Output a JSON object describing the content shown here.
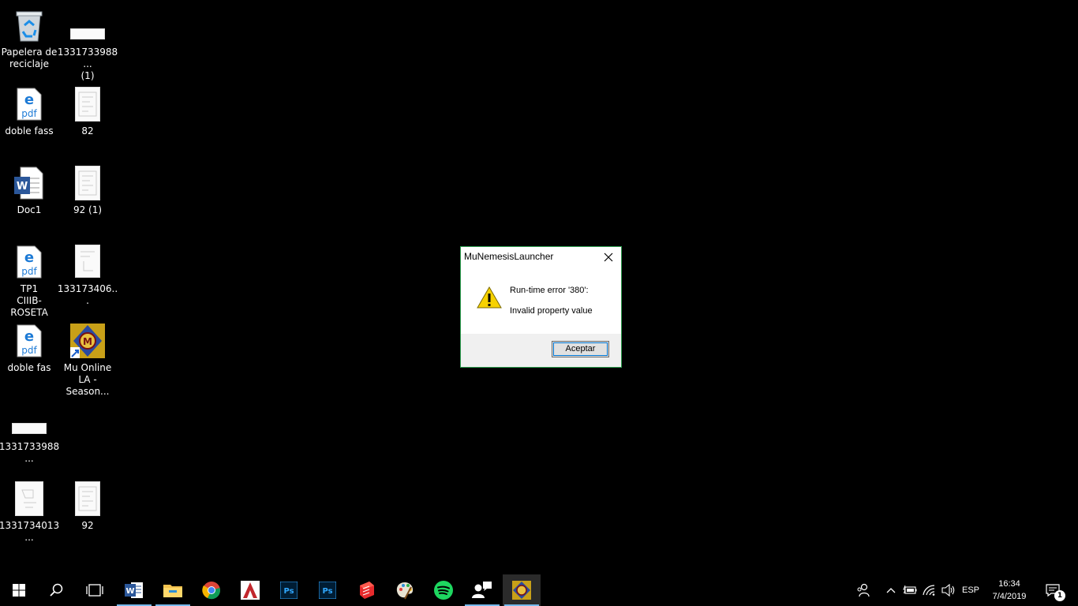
{
  "desktop": {
    "icons": [
      {
        "label": "Papelera de reciclaje",
        "icon": "recycle-bin-icon"
      },
      {
        "label": "1331733988...\n(1)",
        "icon": "image-file-icon"
      },
      {
        "label": "doble fass",
        "icon": "pdf-edge-icon"
      },
      {
        "label": "82",
        "icon": "image-file-icon"
      },
      {
        "label": "Doc1",
        "icon": "word-document-icon"
      },
      {
        "label": "92 (1)",
        "icon": "image-file-icon"
      },
      {
        "label": "TP1\nCIIIB-ROSETA",
        "icon": "pdf-edge-icon"
      },
      {
        "label": "133173406...",
        "icon": "image-file-icon"
      },
      {
        "label": "doble fas",
        "icon": "pdf-edge-icon"
      },
      {
        "label": "Mu Online\nLA - Season...",
        "icon": "mu-online-shortcut-icon"
      },
      {
        "label": "1331733988...",
        "icon": "image-file-icon"
      },
      {
        "label": "1331734013...",
        "icon": "image-file-icon"
      },
      {
        "label": "92",
        "icon": "image-file-icon"
      }
    ]
  },
  "dialog": {
    "title": "MuNemesisLauncher",
    "message_line1": "Run-time error '380':",
    "message_line2": "Invalid property value",
    "ok_label": "Aceptar",
    "icon": "warning-icon"
  },
  "taskbar": {
    "pinned": [
      {
        "name": "start",
        "icon": "windows-start-icon"
      },
      {
        "name": "search",
        "icon": "search-icon"
      },
      {
        "name": "task-view",
        "icon": "task-view-icon"
      },
      {
        "name": "word",
        "icon": "word-icon"
      },
      {
        "name": "file-explorer",
        "icon": "folder-icon"
      },
      {
        "name": "chrome",
        "icon": "chrome-icon"
      },
      {
        "name": "autocad",
        "icon": "autocad-icon"
      },
      {
        "name": "photoshop-1",
        "icon": "photoshop-icon"
      },
      {
        "name": "photoshop-2",
        "icon": "photoshop-icon"
      },
      {
        "name": "sketchup",
        "icon": "sketchup-icon"
      },
      {
        "name": "paint",
        "icon": "palette-icon"
      },
      {
        "name": "spotify",
        "icon": "spotify-icon"
      },
      {
        "name": "people-app",
        "icon": "people-icon"
      },
      {
        "name": "mu-launcher",
        "icon": "mu-launcher-icon"
      }
    ],
    "language": "ESP",
    "time": "16:34",
    "date": "7/4/2019",
    "notifications_count": "1"
  },
  "colors": {
    "dialog_border": "#2d9e4f",
    "running_indicator": "#76b9ed",
    "warning_yellow": "#f7d200"
  }
}
